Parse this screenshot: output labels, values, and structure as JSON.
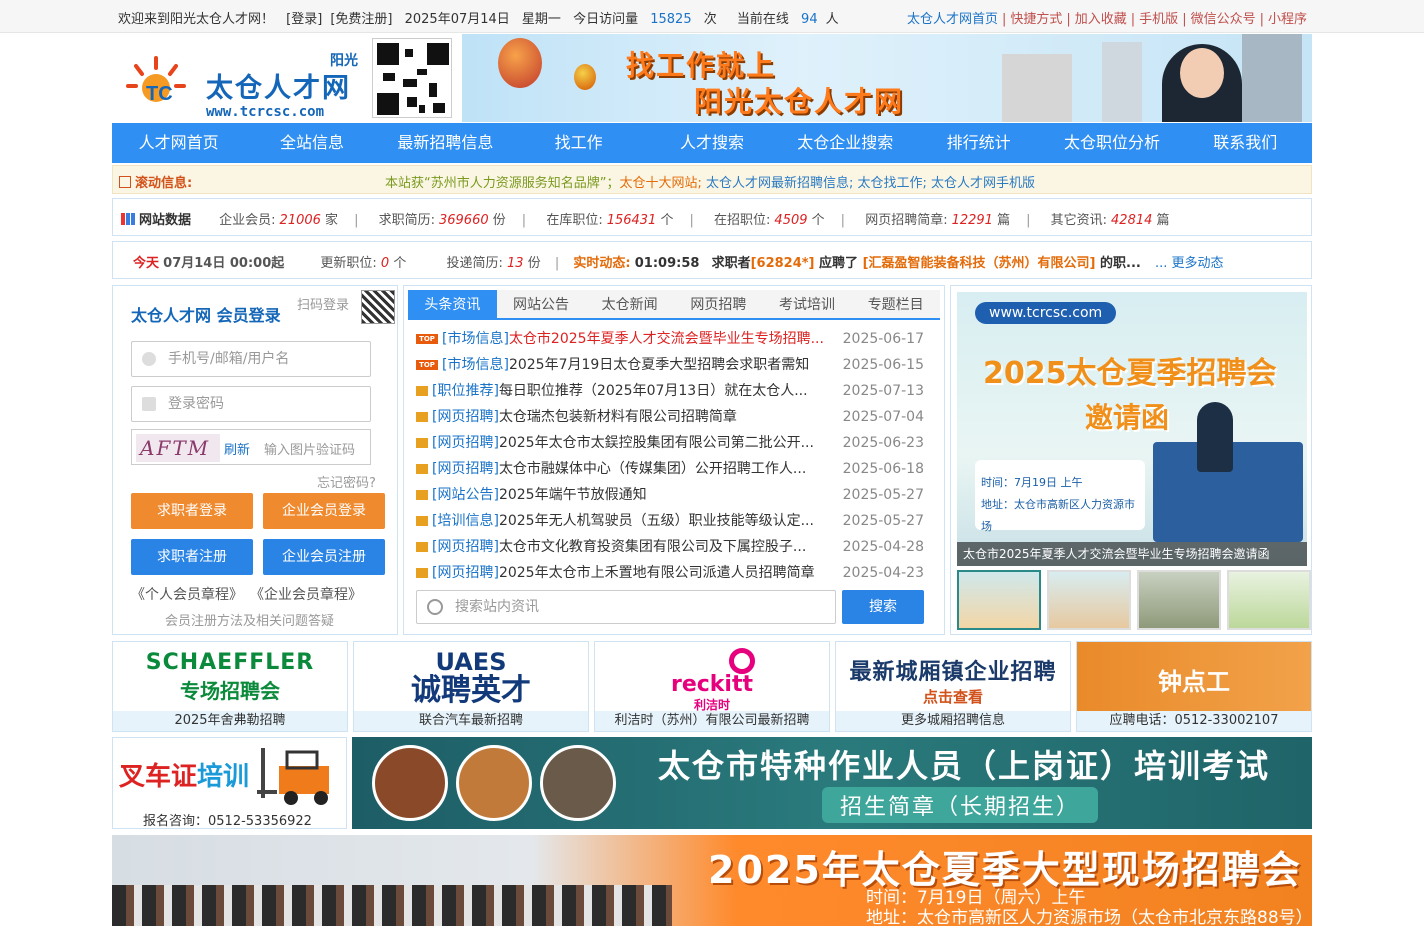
{
  "topbar": {
    "welcome": "欢迎来到阳光太仓人才网！",
    "login": "[登录]",
    "register": "[免费注册]",
    "date": "2025年07月14日",
    "weekday": "星期一",
    "visits_label": "今日访问量",
    "visits": "15825",
    "visits_unit": "次",
    "online_label": "当前在线",
    "online": "94",
    "online_unit": "人",
    "links": [
      "太仓人才网首页",
      "快捷方式",
      "加入收藏",
      "手机版",
      "微信公众号",
      "小程序"
    ]
  },
  "header": {
    "logo_top": "阳光",
    "logo_name": "太仓人才网",
    "logo_url": "www.tcrcsc.com",
    "banner_line1": "找工作就上",
    "banner_line2": "阳光太仓人才网"
  },
  "nav": [
    "人才网首页",
    "全站信息",
    "最新招聘信息",
    "找工作",
    "人才搜索",
    "太仓企业搜索",
    "排行统计",
    "太仓职位分析",
    "联系我们"
  ],
  "scroll": {
    "label": "滚动信息:",
    "text_green": "本站获“苏州市人力资源服务知名品牌”；",
    "text_orange": "太仓十大网站;",
    "text_blue": "太仓人才网最新招聘信息; 太仓找工作; 太仓人才网手机版"
  },
  "stats": {
    "title": "网站数据",
    "items": [
      {
        "label": "企业会员:",
        "value": "21006",
        "unit": "家"
      },
      {
        "label": "求职简历:",
        "value": "369660",
        "unit": "份"
      },
      {
        "label": "在库职位:",
        "value": "156431",
        "unit": "个"
      },
      {
        "label": "在招职位:",
        "value": "4509",
        "unit": "个"
      },
      {
        "label": "网页招聘简章:",
        "value": "12291",
        "unit": "篇"
      },
      {
        "label": "其它资讯:",
        "value": "42814",
        "unit": "篇"
      }
    ]
  },
  "today": {
    "label": "今天",
    "time": "07月14日 00:00起",
    "jobs_label": "更新职位:",
    "jobs": "0",
    "jobs_unit": "个",
    "resumes_label": "投递简历:",
    "resumes": "13",
    "resumes_unit": "份",
    "live_label": "实时动态:",
    "live_time": "01:09:58",
    "live_text1": "求职者",
    "live_id": "[62824*]",
    "live_text2": "应聘了",
    "live_company": "[汇磊盈智能装备科技（苏州）有限公司]",
    "live_rest": "的职...",
    "more": "... 更多动态"
  },
  "login": {
    "title": "太仓人才网 会员登录",
    "scan": "扫码登录",
    "user_placeholder": "手机号/邮箱/用户名",
    "pwd_placeholder": "登录密码",
    "captcha_text": "AFTM",
    "refresh": "刷新",
    "captcha_placeholder": "输入图片验证码",
    "forgot": "忘记密码?",
    "btn_seeker_login": "求职者登录",
    "btn_company_login": "企业会员登录",
    "btn_seeker_reg": "求职者注册",
    "btn_company_reg": "企业会员注册",
    "rules_personal": "《个人会员章程》",
    "rules_company": "《企业会员章程》",
    "faq": "会员注册方法及相关问题答疑"
  },
  "news": {
    "tabs": [
      "头条资讯",
      "网站公告",
      "太仓新闻",
      "网页招聘",
      "考试培训",
      "专题栏目"
    ],
    "items": [
      {
        "cat": "[市场信息]",
        "title": "太仓市2025年夏季人才交流会暨毕业生专场招聘...",
        "date": "2025-06-17",
        "top": true,
        "hot": true
      },
      {
        "cat": "[市场信息]",
        "title": "2025年7月19日太仓夏季大型招聘会求职者需知",
        "date": "2025-06-15",
        "top": true,
        "hot": false
      },
      {
        "cat": "[职位推荐]",
        "title": "每日职位推荐（2025年07月13日）就在太仓人...",
        "date": "2025-07-13",
        "top": false,
        "hot": false
      },
      {
        "cat": "[网页招聘]",
        "title": "太仓瑞杰包装新材料有限公司招聘简章",
        "date": "2025-07-04",
        "top": false,
        "hot": false
      },
      {
        "cat": "[网页招聘]",
        "title": "2025年太仓市太鋘控股集团有限公司第二批公开...",
        "date": "2025-06-23",
        "top": false,
        "hot": false
      },
      {
        "cat": "[网页招聘]",
        "title": "太仓市融媒体中心（传媒集团）公开招聘工作人...",
        "date": "2025-06-18",
        "top": false,
        "hot": false
      },
      {
        "cat": "[网站公告]",
        "title": "2025年端午节放假通知",
        "date": "2025-05-27",
        "top": false,
        "hot": false
      },
      {
        "cat": "[培训信息]",
        "title": "2025年无人机驾驶员（五级）职业技能等级认定...",
        "date": "2025-05-27",
        "top": false,
        "hot": false
      },
      {
        "cat": "[网页招聘]",
        "title": "太仓市文化教育投资集团有限公司及下属控股子...",
        "date": "2025-04-28",
        "top": false,
        "hot": false
      },
      {
        "cat": "[网页招聘]",
        "title": "2025年太仓市上禾置地有限公司派遣人员招聘简章",
        "date": "2025-04-23",
        "top": false,
        "hot": false
      }
    ],
    "search_placeholder": "搜索站内资讯",
    "search_btn": "搜索"
  },
  "slide": {
    "url": "www.tcrcsc.com",
    "title1": "2025太仓夏季招聘会",
    "title2": "邀请函",
    "time": "时间：7月19日 上午",
    "addr": "地址：太仓市高新区人力资源市场",
    "caption": "太仓市2025年夏季人才交流会暨毕业生专场招聘会邀请函"
  },
  "ads": [
    {
      "art1": "SCHAEFFLER",
      "art2": "专场招聘会",
      "label": "2025年舍弗勒招聘"
    },
    {
      "art1": "UAES",
      "art2": "诚聘英才",
      "label": "联合汽车最新招聘"
    },
    {
      "art1": "reckitt",
      "art2": "利洁时",
      "label": "利洁时（苏州）有限公司最新招聘"
    },
    {
      "art1": "最新城厢镇企业招聘",
      "art2": "点击查看",
      "label": "更多城厢招聘信息"
    },
    {
      "art1": "钟点工",
      "art2": "",
      "label": "应聘电话：0512-33002107"
    }
  ],
  "forklift": {
    "title_red": "叉车证",
    "title_blue": "培训",
    "tel": "报名咨询：0512-53356922"
  },
  "training": {
    "title": "太仓市特种作业人员（上岗证）培训考试",
    "sub": "招生简章（长期招生）"
  },
  "fair": {
    "title": "2025年太仓夏季大型现场招聘会",
    "time": "时间：7月19日（周六）上午",
    "addr": "地址：太仓市高新区人力资源市场（太仓市北京东路88号）"
  },
  "colors": {
    "primary": "#2f8ff2",
    "accent": "#f08a2e",
    "link": "#1a73c8",
    "hot": "#dd2222"
  }
}
